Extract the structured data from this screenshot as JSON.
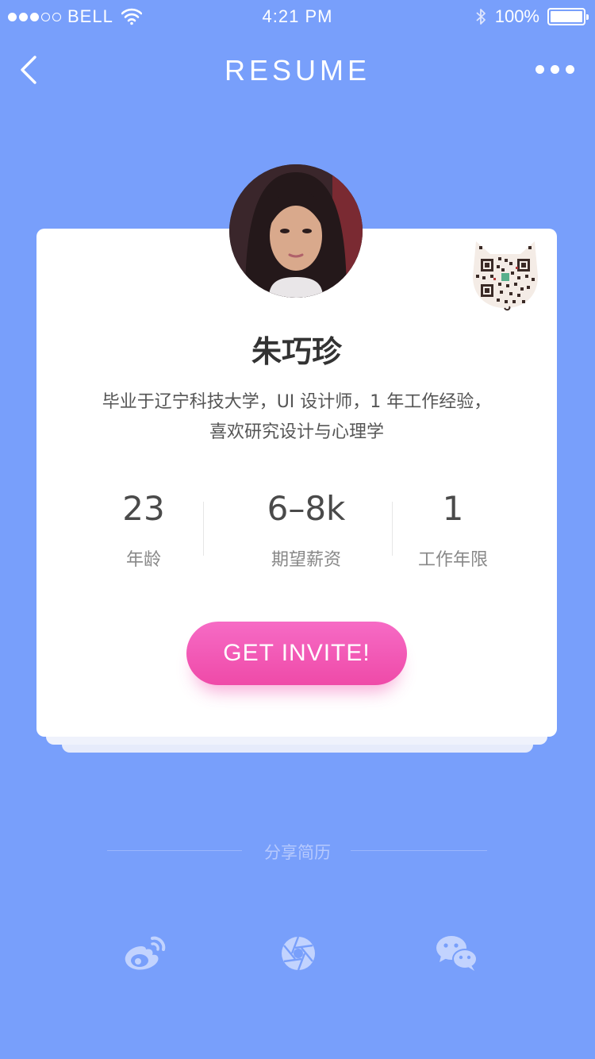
{
  "status_bar": {
    "carrier": "BELL",
    "time": "4:21 PM",
    "battery": "100%",
    "signal_bars_filled": 3,
    "signal_bars_total": 5
  },
  "nav": {
    "title": "RESUME",
    "back_icon": "chevron-left-icon",
    "more_icon": "more-dots-icon"
  },
  "profile": {
    "name": "朱巧珍",
    "bio_line1": "毕业于辽宁科技大学，UI 设计师，1 年工作经验，",
    "bio_line2": "喜欢研究设计与心理学"
  },
  "stats": [
    {
      "value": "23",
      "label": "年龄"
    },
    {
      "value": "6–8k",
      "label": "期望薪资"
    },
    {
      "value": "1",
      "label": "工作年限"
    }
  ],
  "invite_button": {
    "label": "GET INVITE!"
  },
  "share": {
    "title": "分享简历",
    "icons": [
      "weibo-icon",
      "camera-aperture-icon",
      "wechat-icon"
    ]
  },
  "colors": {
    "background": "#789ffb",
    "accent": "#f35ab7",
    "card": "#ffffff"
  }
}
